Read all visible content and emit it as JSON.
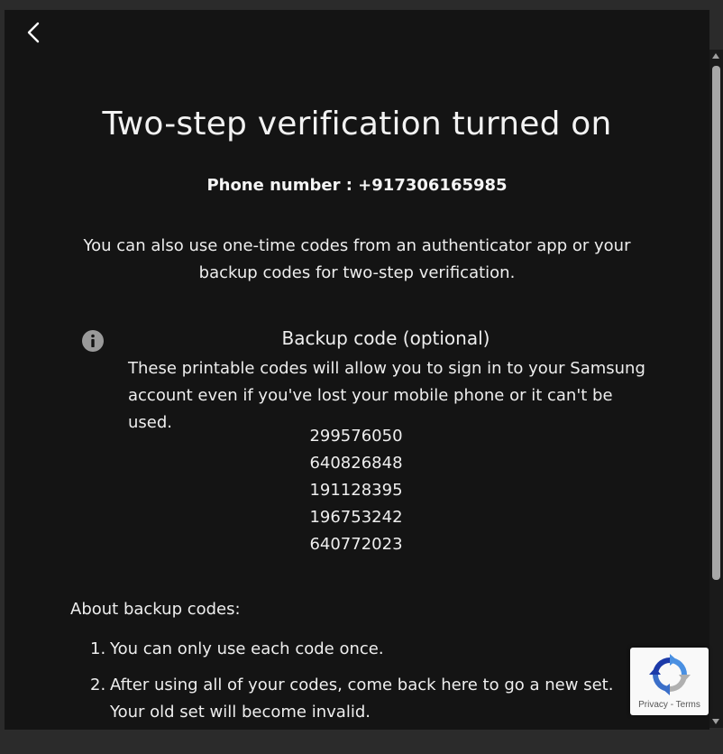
{
  "header": {
    "back_icon": "chevron-left-icon"
  },
  "main": {
    "title": "Two-step verification turned on",
    "phone_label": "Phone number : +917306165985",
    "intro_line1": "You can also use one-time codes from an authenticator app or your",
    "intro_line2": "backup codes for two-step verification.",
    "info_icon": "info-icon",
    "backup_title": "Backup code (optional)",
    "backup_desc": "These printable codes will allow you to sign in to your Samsung account even if you've lost your mobile phone or it can't be used.",
    "codes": [
      "299576050",
      "640826848",
      "191128395",
      "196753242",
      "640772023"
    ],
    "about_title": "About backup codes:",
    "about_items": [
      {
        "num": "1.",
        "text": "You can only use each code once."
      },
      {
        "num": "2.",
        "text": "After using all of your codes, come back here to go a new set. Your old set will become invalid."
      }
    ]
  },
  "recaptcha": {
    "privacy": "Privacy",
    "separator": " - ",
    "terms": "Terms"
  },
  "colors": {
    "background": "#141414",
    "text": "#eeeeee",
    "page_frame": "#2b2b2b"
  }
}
